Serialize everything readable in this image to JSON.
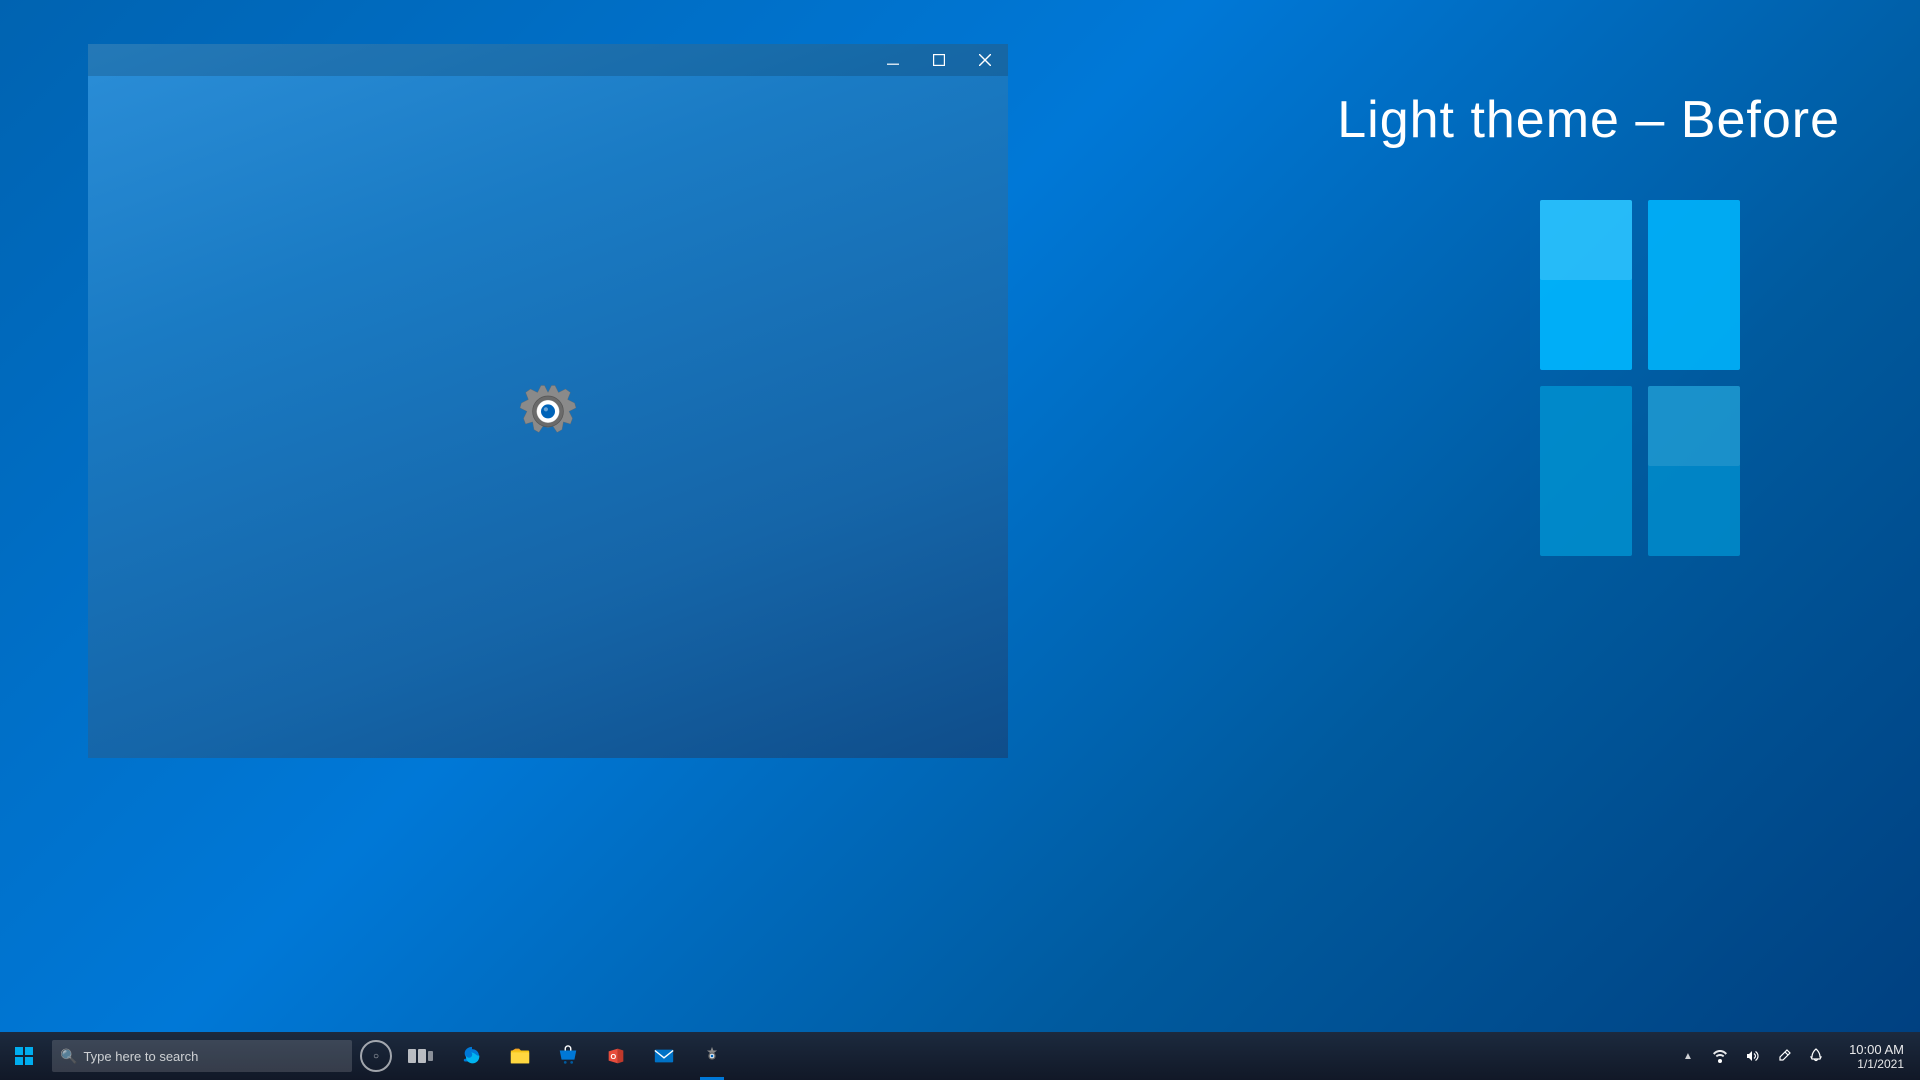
{
  "desktop": {
    "background_color": "#0063b1"
  },
  "theme_label": {
    "text": "Light theme – Before"
  },
  "window": {
    "title": "Settings",
    "buttons": {
      "minimize": "–",
      "maximize": "□",
      "close": "✕"
    }
  },
  "taskbar": {
    "search_placeholder": "Type here to search",
    "items": [
      {
        "name": "cortana",
        "label": "Cortana"
      },
      {
        "name": "task-view",
        "label": "Task View"
      },
      {
        "name": "edge",
        "label": "Microsoft Edge"
      },
      {
        "name": "file-explorer",
        "label": "File Explorer"
      },
      {
        "name": "store",
        "label": "Microsoft Store"
      },
      {
        "name": "office",
        "label": "Office"
      },
      {
        "name": "mail",
        "label": "Mail"
      },
      {
        "name": "settings",
        "label": "Settings"
      }
    ],
    "tray": {
      "time": "10:00 AM",
      "date": "1/1/2021"
    }
  }
}
